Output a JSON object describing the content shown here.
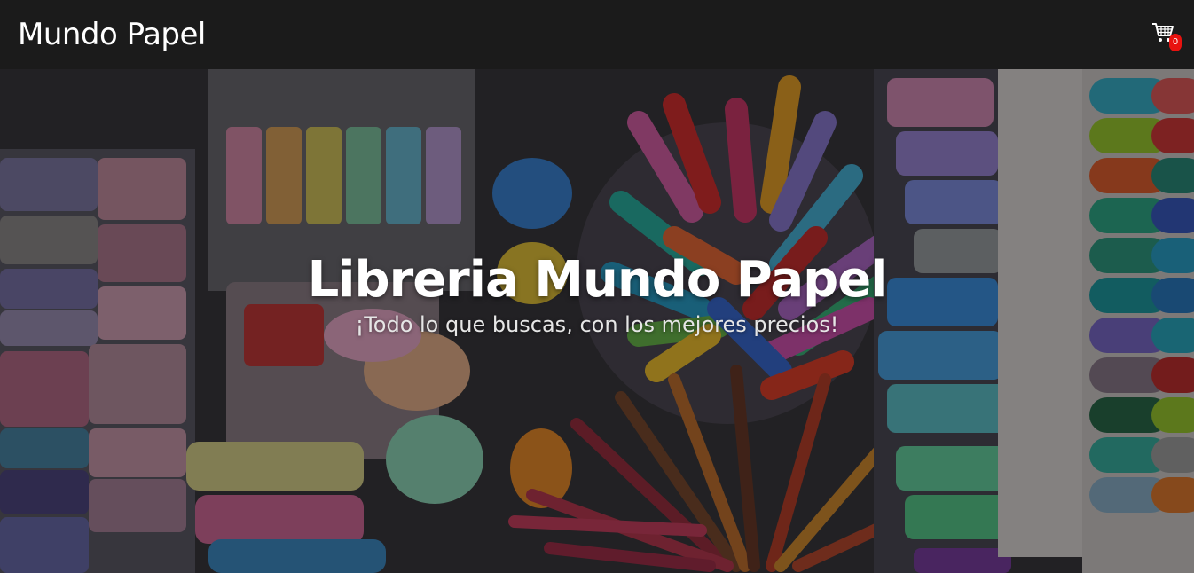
{
  "navbar": {
    "brand": "Mundo Papel",
    "cart": {
      "icon": "shopping-cart-icon",
      "count": "0"
    }
  },
  "hero": {
    "title": "Libreria Mundo Papel",
    "subtitle": "¡Todo lo que buscas, con los mejores precios!",
    "background_image": "stationery-markers-washi-tape-photo"
  },
  "colors": {
    "navbar_bg": "#1b1b1b",
    "badge": "#e8120f",
    "text": "#ffffff"
  }
}
